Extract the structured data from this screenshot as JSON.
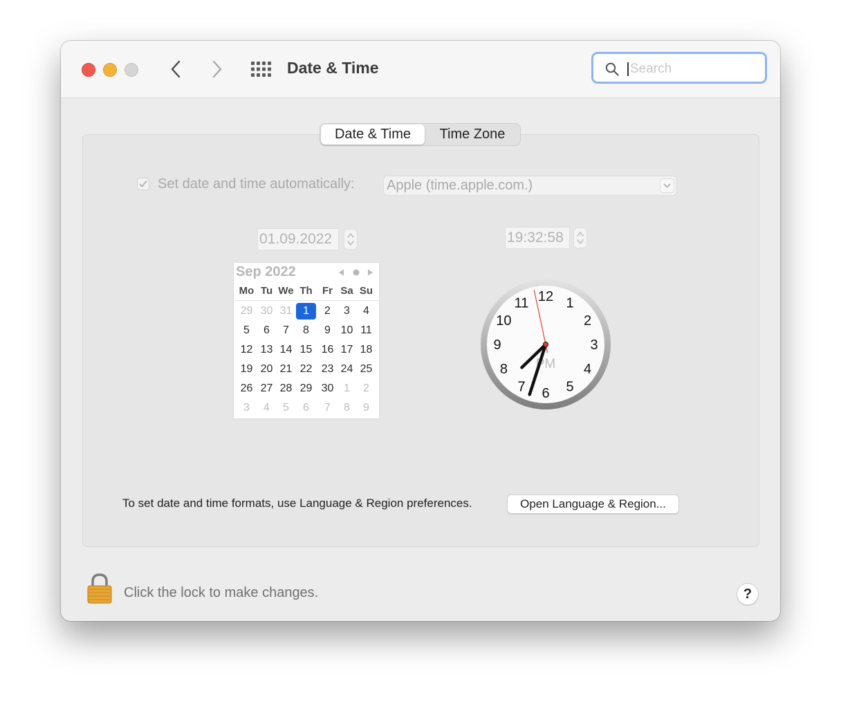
{
  "window": {
    "title": "Date & Time",
    "search_placeholder": "Search"
  },
  "tabs": [
    {
      "label": "Date & Time",
      "active": true
    },
    {
      "label": "Time Zone",
      "active": false
    }
  ],
  "auto_time": {
    "label": "Set date and time automatically:",
    "checked": true,
    "server": "Apple (time.apple.com.)"
  },
  "date_field": "01.09.2022",
  "time_field": "19:32:58",
  "calendar": {
    "month_label": "Sep 2022",
    "weekdays": [
      "Mo",
      "Tu",
      "We",
      "Th",
      "Fr",
      "Sa",
      "Su"
    ],
    "weeks": [
      [
        "29",
        "30",
        "31",
        "1",
        "2",
        "3",
        "4"
      ],
      [
        "5",
        "6",
        "7",
        "8",
        "9",
        "10",
        "11"
      ],
      [
        "12",
        "13",
        "14",
        "15",
        "16",
        "17",
        "18"
      ],
      [
        "19",
        "20",
        "21",
        "22",
        "23",
        "24",
        "25"
      ],
      [
        "26",
        "27",
        "28",
        "29",
        "30",
        "1",
        "2"
      ],
      [
        "3",
        "4",
        "5",
        "6",
        "7",
        "8",
        "9"
      ]
    ],
    "selected_day": "1"
  },
  "clock": {
    "numbers": [
      "12",
      "1",
      "2",
      "3",
      "4",
      "5",
      "6",
      "7",
      "8",
      "9",
      "10",
      "11"
    ],
    "ampm": "PM",
    "hours": 19,
    "minutes": 32,
    "seconds": 58
  },
  "formats_hint": "To set date and time formats, use Language & Region preferences.",
  "open_region_button": "Open Language & Region...",
  "lock_message": "Click the lock to make changes.",
  "help_label": "?",
  "colors": {
    "accent": "#1b66d9",
    "close": "#ee5a52",
    "minimize": "#f3b33b",
    "second_hand": "#e2402f"
  }
}
